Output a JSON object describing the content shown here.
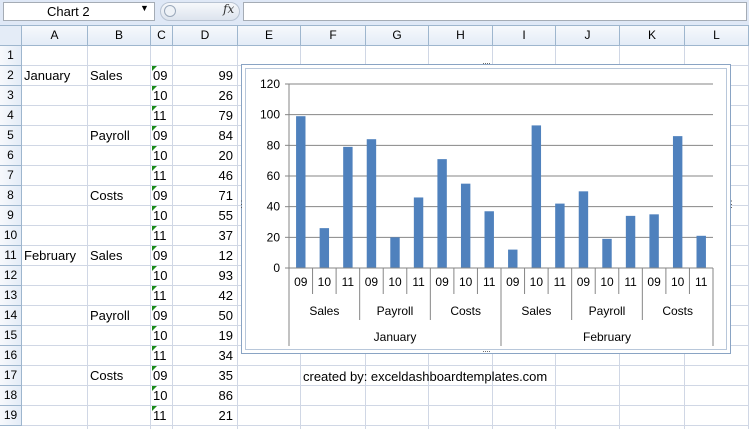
{
  "name_box": "Chart 2",
  "formula_bar": {
    "fx_label": "fx",
    "value": ""
  },
  "columns": [
    "A",
    "B",
    "C",
    "D",
    "E",
    "F",
    "G",
    "H",
    "I",
    "J",
    "K",
    "L"
  ],
  "rows": [
    "1",
    "2",
    "3",
    "4",
    "5",
    "6",
    "7",
    "8",
    "9",
    "10",
    "11",
    "12",
    "13",
    "14",
    "15",
    "16",
    "17",
    "18",
    "19"
  ],
  "cells": {
    "A2": "January",
    "B2": "Sales",
    "C2": "09",
    "D2": "99",
    "C3": "10",
    "D3": "26",
    "C4": "11",
    "D4": "79",
    "B5": "Payroll",
    "C5": "09",
    "D5": "84",
    "C6": "10",
    "D6": "20",
    "C7": "11",
    "D7": "46",
    "B8": "Costs",
    "C8": "09",
    "D8": "71",
    "C9": "10",
    "D9": "55",
    "C10": "11",
    "D10": "37",
    "A11": "February",
    "B11": "Sales",
    "C11": "09",
    "D11": "12",
    "C12": "10",
    "D12": "93",
    "C13": "11",
    "D13": "42",
    "B14": "Payroll",
    "C14": "09",
    "D14": "50",
    "C15": "10",
    "D15": "19",
    "C16": "11",
    "D16": "34",
    "B17": "Costs",
    "C17": "09",
    "D17": "35",
    "C18": "10",
    "D18": "86",
    "C19": "11",
    "D19": "21",
    "E17": "created by: exceldashboardtemplates.com"
  },
  "chart_data": {
    "type": "bar",
    "color": "#4f81bd",
    "ylim": [
      0,
      120
    ],
    "yticks": [
      0,
      20,
      40,
      60,
      80,
      100,
      120
    ],
    "grid": true,
    "categories": [
      "09",
      "10",
      "11",
      "09",
      "10",
      "11",
      "09",
      "10",
      "11",
      "09",
      "10",
      "11",
      "09",
      "10",
      "11",
      "09",
      "10",
      "11"
    ],
    "values": [
      99,
      26,
      79,
      84,
      20,
      46,
      71,
      55,
      37,
      12,
      93,
      42,
      50,
      19,
      34,
      35,
      86,
      21
    ],
    "group_level_1": [
      "Sales",
      "Payroll",
      "Costs",
      "Sales",
      "Payroll",
      "Costs"
    ],
    "group_level_2": [
      "January",
      "February"
    ]
  }
}
